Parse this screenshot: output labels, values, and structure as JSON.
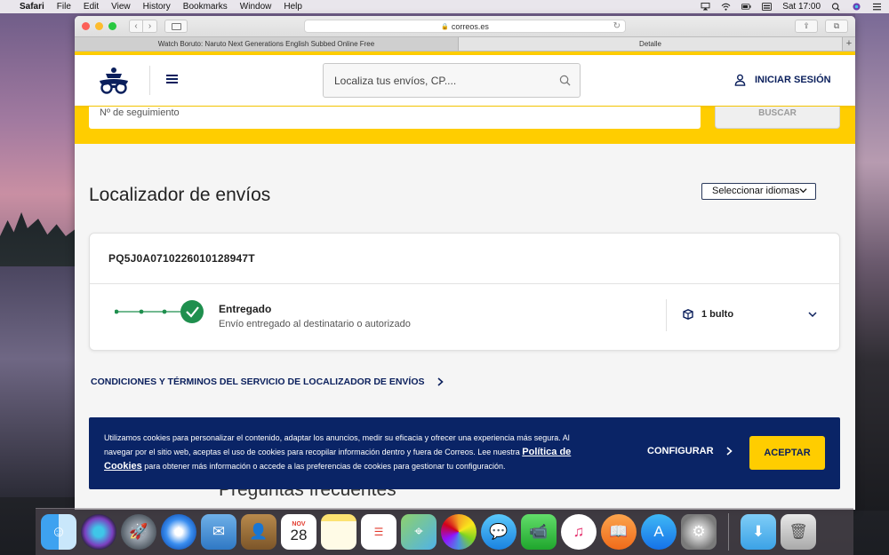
{
  "menubar": {
    "apple_glyph": "",
    "app_name": "Safari",
    "items": [
      "File",
      "Edit",
      "View",
      "History",
      "Bookmarks",
      "Window",
      "Help"
    ],
    "clock": "Sat 17:00"
  },
  "browser": {
    "url": "correos.es",
    "tabs": [
      {
        "title": "Watch Boruto: Naruto Next Generations English Subbed Online Free"
      },
      {
        "title": "Detalle"
      }
    ],
    "new_tab_glyph": "+"
  },
  "header": {
    "search_placeholder": "Localiza tus envíos, CP....",
    "login_label": "INICIAR SESIÓN"
  },
  "tracking_form": {
    "input_placeholder": "Nº de seguimiento",
    "search_button": "BUSCAR"
  },
  "locator": {
    "title": "Localizador de envíos",
    "language_select": "Seleccionar idiomas"
  },
  "shipment": {
    "tracking_number": "PQ5J0A0710226010128947T",
    "status_title": "Entregado",
    "status_description": "Envío entregado al destinatario o autorizado",
    "package_count": "1 bulto",
    "status_color": "#1f8f4e"
  },
  "terms": {
    "link_text": "CONDICIONES Y TÉRMINOS DEL SERVICIO DE LOCALIZADOR DE ENVÍOS"
  },
  "faq": {
    "heading": "Preguntas frecuentes"
  },
  "cookie_banner": {
    "text_before": "Utilizamos cookies para personalizar el contenido, adaptar los anuncios, medir su eficacia y ofrecer una experiencia más segura. Al navegar por el sitio web, aceptas el uso de cookies para recopilar información dentro y fuera de Correos. Lee nuestra ",
    "policy_link": "Política de Cookies",
    "text_after": " para obtener más información o accede a las preferencias de cookies para gestionar tu configuración.",
    "configure_label": "CONFIGURAR",
    "accept_label": "ACEPTAR"
  },
  "colors": {
    "brand_yellow": "#ffcd00",
    "brand_navy": "#0a1f5c"
  },
  "dock": {
    "calendar_month": "NOV",
    "calendar_day": "28",
    "apps": [
      "finder-icon",
      "siri-icon",
      "launchpad-icon",
      "safari-icon",
      "mail-icon",
      "contacts-icon",
      "calendar-icon",
      "notes-icon",
      "reminders-icon",
      "maps-icon",
      "photos-icon",
      "messages-icon",
      "facetime-icon",
      "itunes-icon",
      "ibooks-icon",
      "app-store-icon",
      "system-preferences-icon",
      "downloads-icon",
      "trash-icon"
    ]
  }
}
